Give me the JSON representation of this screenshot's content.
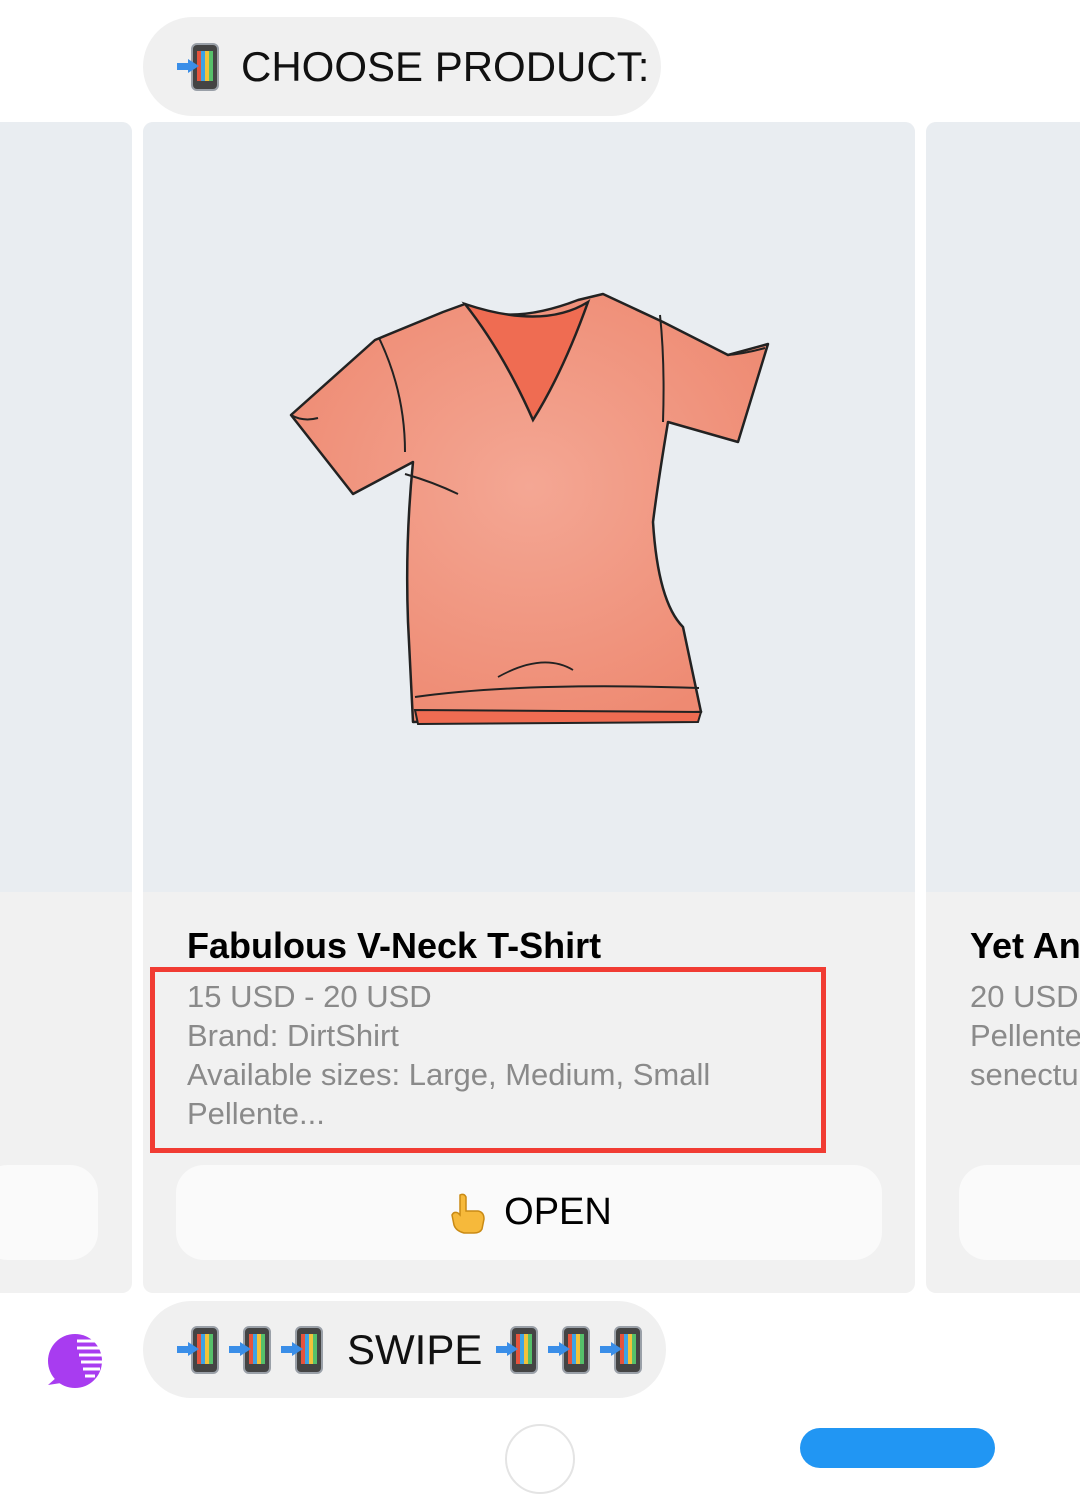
{
  "messages": {
    "choose_label": "CHOOSE PRODUCT:",
    "swipe_label": "SWIPE"
  },
  "carousel": {
    "main_card": {
      "title": "Fabulous V-Neck T-Shirt",
      "price": "15 USD - 20 USD",
      "brand": "Brand: DirtShirt",
      "sizes": "Available sizes: Large, Medium, Small",
      "snippet": "Pellente...",
      "button_label": "OPEN",
      "button_icon": "pointing-hand-icon"
    },
    "right_card": {
      "title": "Yet An",
      "price": "20 USD",
      "line2": "Pellente",
      "line3": "senectu"
    }
  },
  "icons": {
    "message_icon": "mobile-phone-with-arrow-icon",
    "bot_avatar": "chat-bot-avatar-icon"
  },
  "colors": {
    "bubble_bg": "#f0f0f0",
    "card_image_bg": "#e9edf1",
    "highlight_border": "#f13c33",
    "send_button": "#2196f3",
    "shirt": "#f0907a",
    "avatar_purple": "#a83cf0"
  }
}
